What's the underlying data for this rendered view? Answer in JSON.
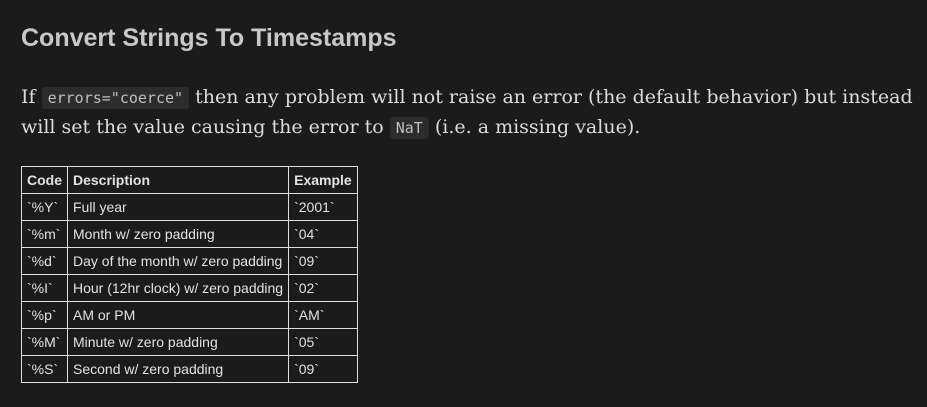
{
  "heading": "Convert Strings To Timestamps",
  "paragraph": {
    "part1": "If ",
    "code1": "errors=\"coerce\"",
    "part2": " then any problem will not raise an error (the default behavior) but instead will set the value causing the error to ",
    "code2": "NaT",
    "part3": " (i.e. a missing value)."
  },
  "table": {
    "headers": [
      "Code",
      "Description",
      "Example"
    ],
    "rows": [
      [
        "`%Y`",
        "Full year",
        "`2001`"
      ],
      [
        "`%m`",
        "Month w/ zero padding",
        "`04`"
      ],
      [
        "`%d`",
        "Day of the month w/ zero padding",
        "`09`"
      ],
      [
        "`%I`",
        "Hour (12hr clock) w/ zero padding",
        "`02`"
      ],
      [
        "`%p`",
        "AM or PM",
        "`AM`"
      ],
      [
        "`%M`",
        "Minute w/ zero padding",
        "`05`"
      ],
      [
        "`%S`",
        "Second w/ zero padding",
        "`09`"
      ]
    ]
  }
}
